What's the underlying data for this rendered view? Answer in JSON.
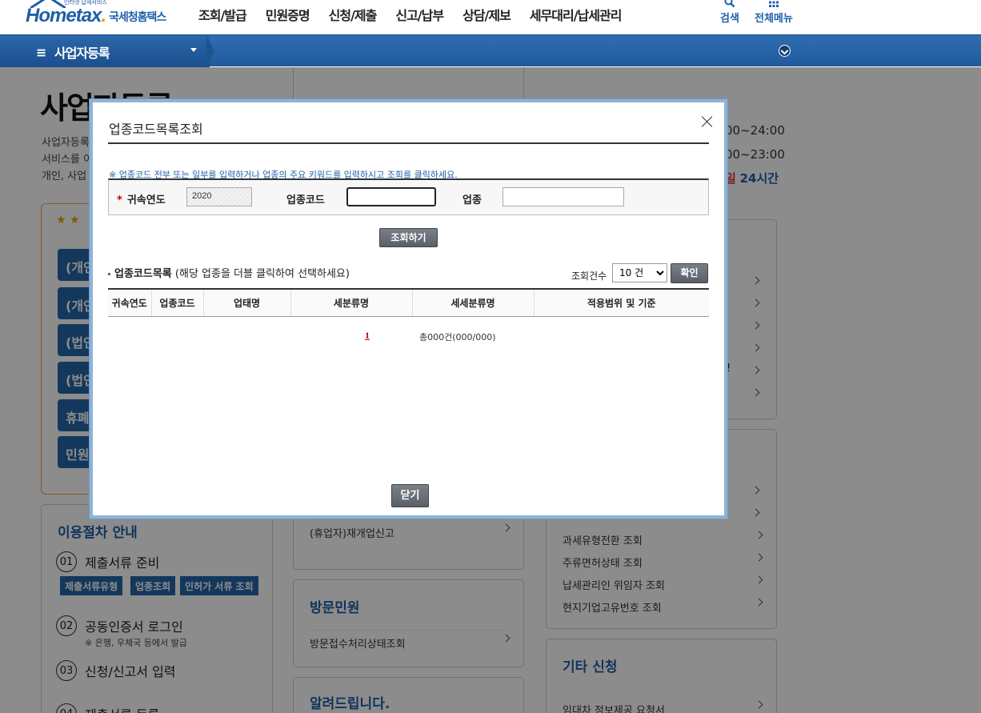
{
  "header": {
    "logo_small": "인터넷 납세서비스",
    "logo_main_a": "Hom",
    "logo_main_b": "e",
    "logo_main_c": "tax",
    "logo_main_d": ".",
    "logo_kor": "국세청홈택스",
    "menu": [
      "조회/발급",
      "민원증명",
      "신청/제출",
      "신고/납부",
      "상담/제보",
      "세무대리/납세관리"
    ],
    "search_label": "검색",
    "all_menu_label": "전체메뉴"
  },
  "navbar": {
    "title": "사업자등록",
    "hamburger": "≡"
  },
  "background": {
    "page_title": "사업자등록",
    "desc": [
      "사업자등록",
      "서비스를 이",
      "개인, 사업"
    ],
    "times": [
      "00~24:00",
      "00~23:00"
    ],
    "time3_red": "일",
    "time3_blue": "24시간",
    "stars": "★ ★",
    "left_buttons": [
      "(개인",
      "(개인",
      "(법인",
      "(법인",
      "휴폐",
      "민원"
    ],
    "proc_title": "이용절차 안내",
    "steps": [
      {
        "num": "01",
        "text": "제출서류 준비"
      },
      {
        "num": "02",
        "text": "공동인증서 로그인"
      },
      {
        "num": "03",
        "text": "신청/신고서 입력"
      },
      {
        "num": "04",
        "text": "제출서류 등록"
      }
    ],
    "step2_sub": "※ 은행, 우체국 등에서 발급",
    "tags": [
      "제출서류유형",
      "업종조회",
      "인허가 서류 조회"
    ],
    "mid_rows": [
      "(휴업자)재개업신고",
      "방문접수처리상태조회"
    ],
    "mid_titles": [
      "방문민원",
      "알려드립니다."
    ],
    "right_rows": [
      "과세유형전환 조회",
      "주류면허상태 조회",
      "납세관리인 위임자 조회",
      "현지기업고유번호 조회",
      "임대차 정보제공 요청서"
    ],
    "right_title": "기타 신청",
    "right_partial": "!"
  },
  "modal": {
    "title": "업종코드목록조회",
    "hint": "※ 업종코드 전부 또는 일부를 입력하거나 업종의 주요 키워드를 입력하시고 조회를 클릭하세요.",
    "required_mark": "*",
    "year_label": "귀속연도",
    "year_value": "2020",
    "code_label": "업종코드",
    "code_value": "",
    "type_label": "업종",
    "type_value": "",
    "search_button": "조회하기",
    "list_title": "업종코드목록",
    "list_desc": "(해당 업종을 더블 클릭하여 선택하세요)",
    "count_label": "조회건수",
    "count_selected": "10 건",
    "confirm_button": "확인",
    "columns": [
      "귀속연도",
      "업종코드",
      "업태명",
      "세분류명",
      "세세분류명",
      "적용범위 및 기준"
    ],
    "page_number": "1",
    "total_text": "총000건(000/000)",
    "close_button": "닫기"
  },
  "colors": {
    "brand": "#1f5fa8",
    "navbar": "#2366a8",
    "accent_orange": "#f0a050"
  }
}
